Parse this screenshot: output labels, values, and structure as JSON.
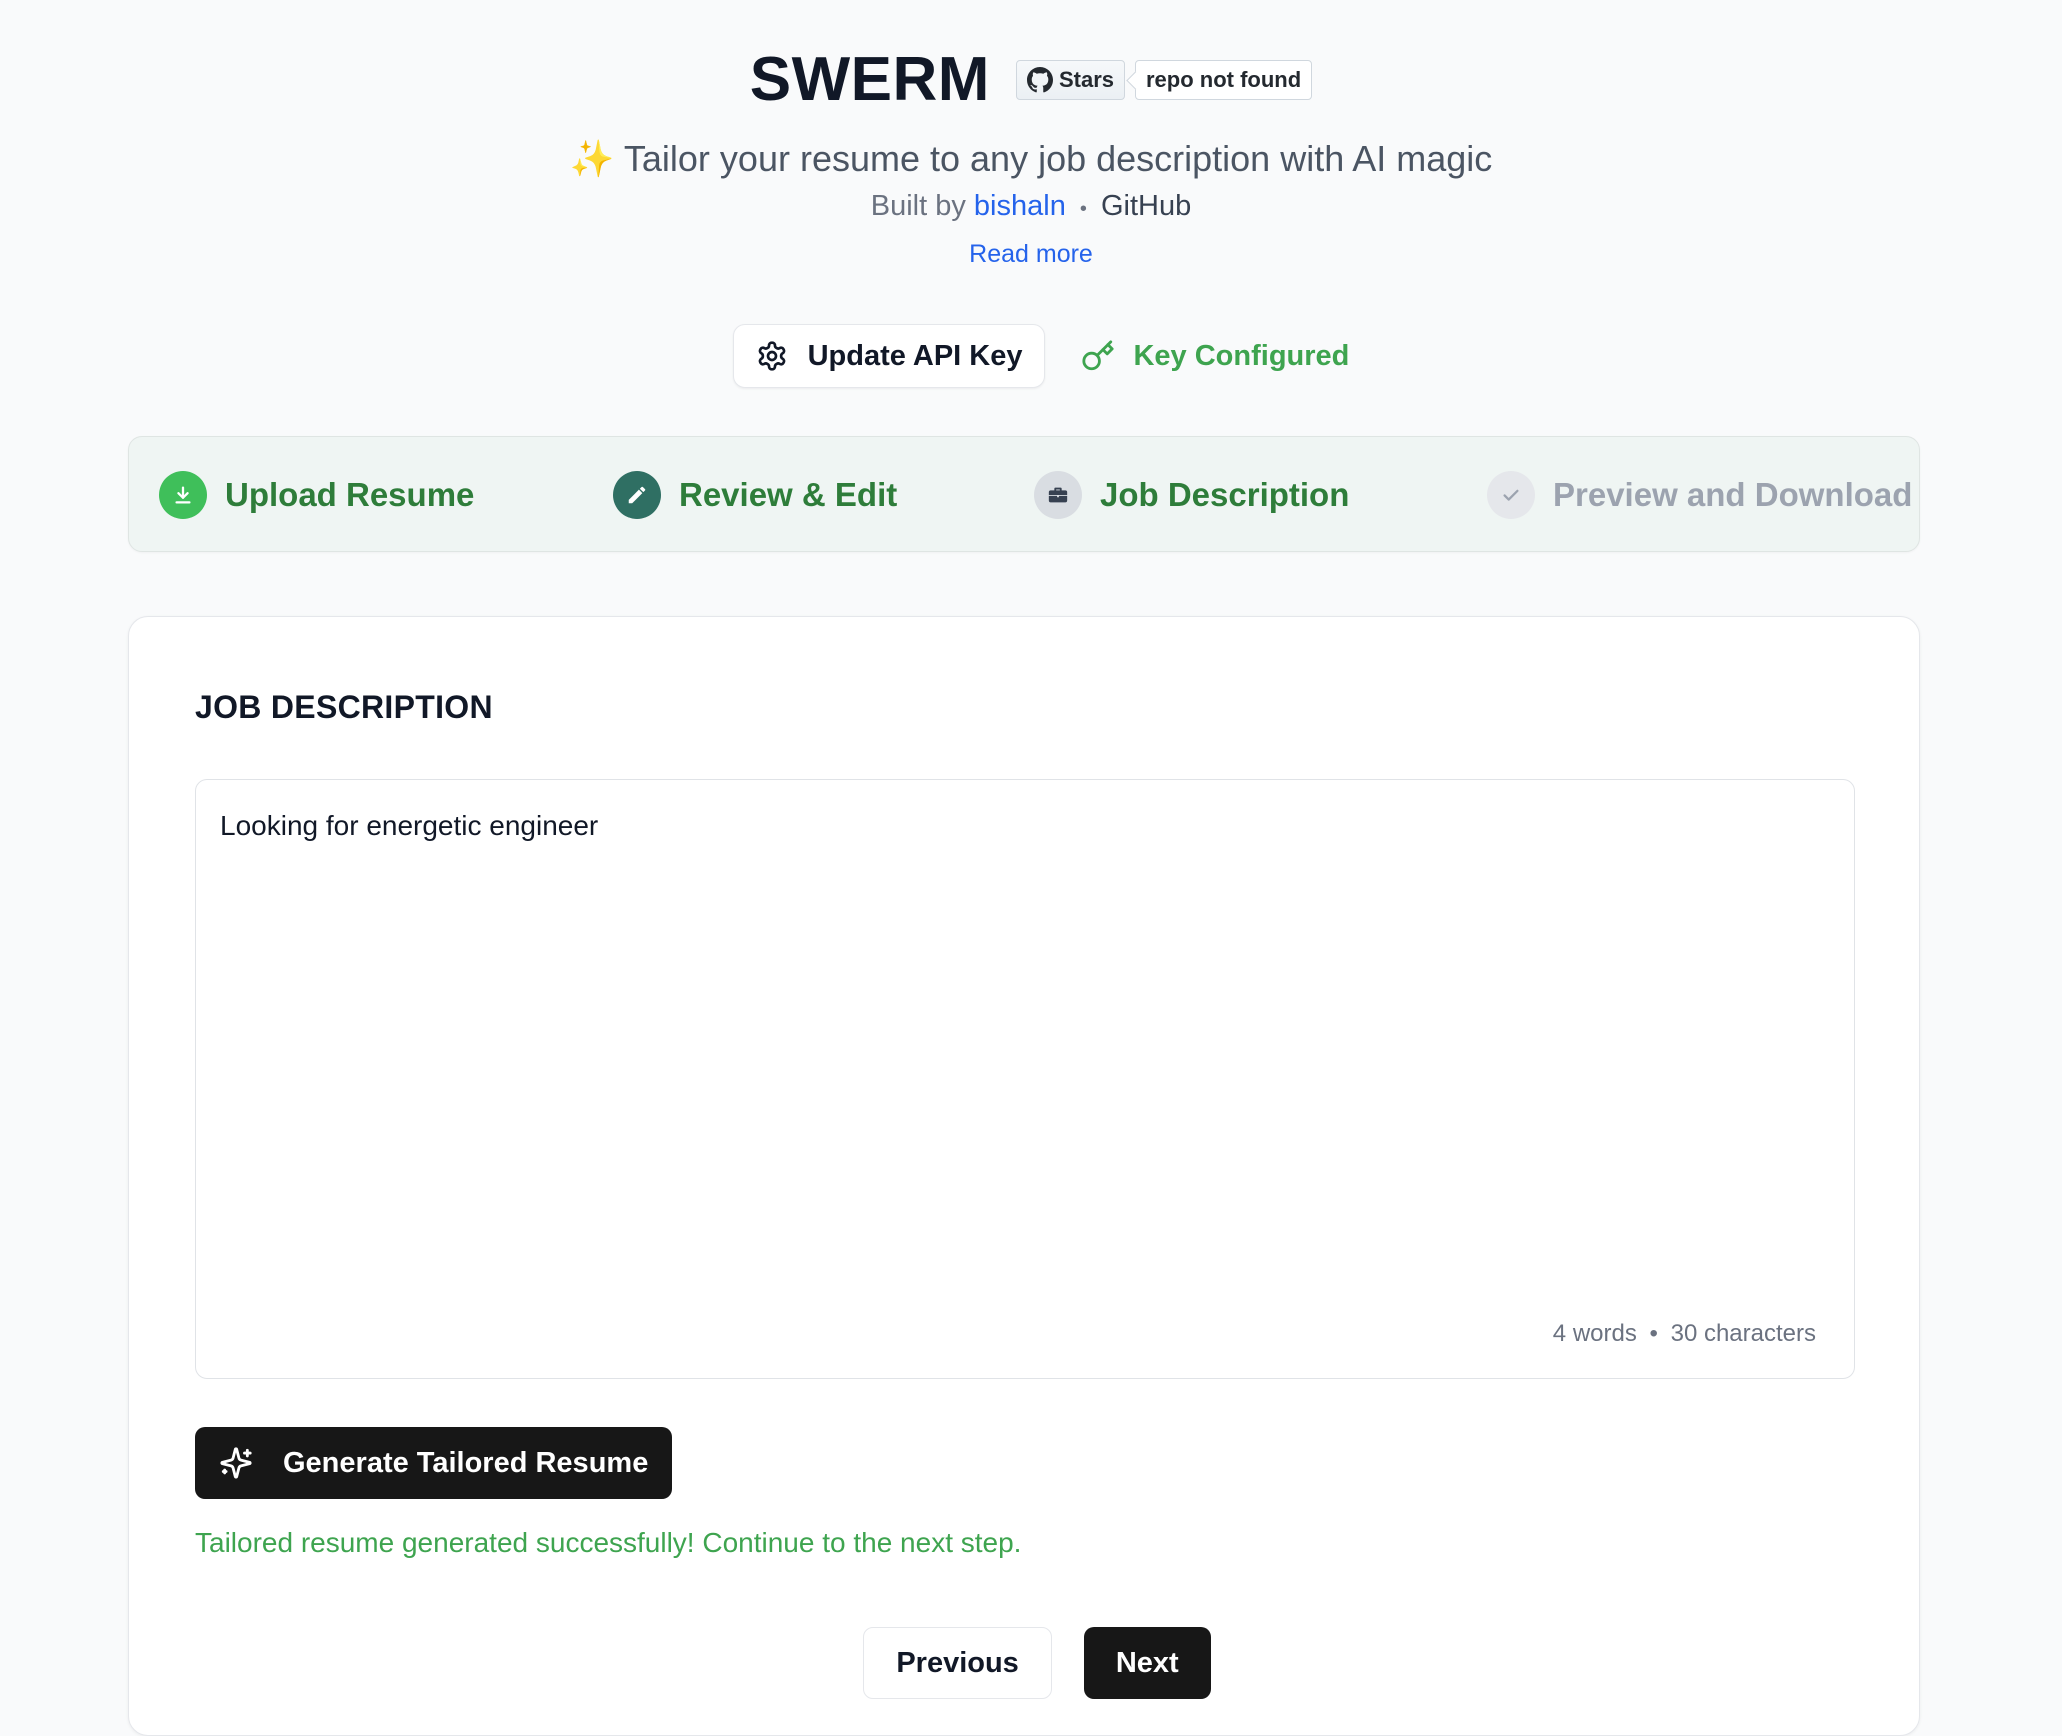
{
  "header": {
    "title": "SWERM",
    "github_badge": {
      "stars_label": "Stars",
      "count_text": "repo not found"
    },
    "tagline_emoji": "✨",
    "tagline": "Tailor your resume to any job description with AI magic",
    "built_by_prefix": "Built by",
    "author": "bishaln",
    "separator": "•",
    "github_link": "GitHub",
    "read_more": "Read more"
  },
  "api": {
    "update_button": "Update API Key",
    "status": "Key Configured"
  },
  "steps": [
    {
      "label": "Upload Resume",
      "state": "completed",
      "icon": "download-icon"
    },
    {
      "label": "Review & Edit",
      "state": "completed",
      "icon": "pencil-icon"
    },
    {
      "label": "Job Description",
      "state": "current",
      "icon": "briefcase-icon"
    },
    {
      "label": "Preview and Download",
      "state": "pending",
      "icon": "check-icon"
    }
  ],
  "job_description": {
    "heading": "JOB DESCRIPTION",
    "value": "Looking for energetic engineer",
    "word_count": "4 words",
    "separator": "•",
    "char_count": "30 characters"
  },
  "actions": {
    "generate_button": "Generate Tailored Resume",
    "success_message": "Tailored resume generated successfully! Continue to the next step.",
    "previous": "Previous",
    "next": "Next"
  },
  "colors": {
    "success_green": "#3ea44f",
    "step_green": "#2e7d3a",
    "teal": "#2f6f63",
    "link_blue": "#2563eb",
    "dark_button": "#171717"
  }
}
